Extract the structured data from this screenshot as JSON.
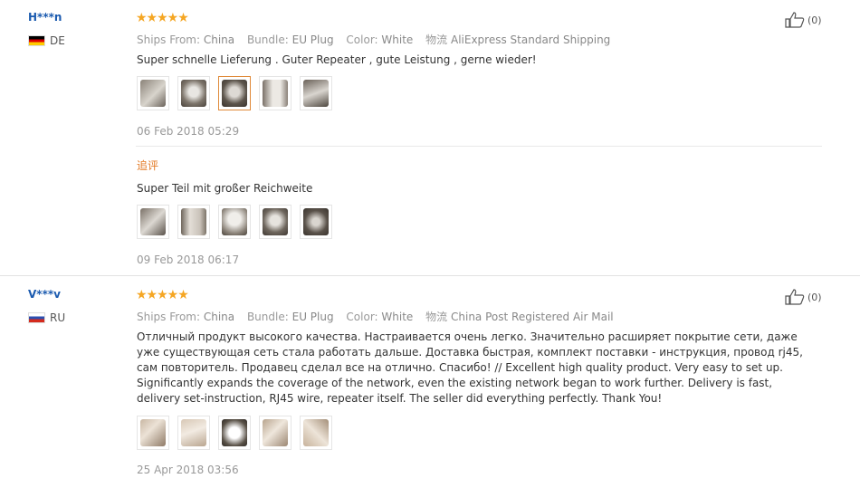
{
  "reviews": [
    {
      "user": "H***n",
      "country": "DE",
      "stars": "★★★★★",
      "likes": "(0)",
      "ships_from_label": "Ships From:",
      "ships_from": "China",
      "bundle_label": "Bundle:",
      "bundle": "EU Plug",
      "color_label": "Color:",
      "color": "White",
      "shipping_label": "物流",
      "shipping": "AliExpress Standard Shipping",
      "text": "Super schnelle Lieferung . Guter Repeater , gute Leistung , gerne wieder!",
      "date": "06 Feb 2018 05:29",
      "followup_label": "追评",
      "followup_text": "Super Teil mit großer Reichweite",
      "followup_date": "09 Feb 2018 06:17"
    },
    {
      "user": "V***v",
      "country": "RU",
      "stars": "★★★★★",
      "likes": "(0)",
      "ships_from_label": "Ships From:",
      "ships_from": "China",
      "bundle_label": "Bundle:",
      "bundle": "EU Plug",
      "color_label": "Color:",
      "color": "White",
      "shipping_label": "物流",
      "shipping": "China Post Registered Air Mail",
      "text": "Отличный продукт высокого качества. Настраивается очень легко. Значительно расширяет покрытие сети, даже уже существующая сеть стала работать дальше. Доставка быстрая, комплект поставки - инструкция, провод rj45, сам повторитель. Продавец сделал все на отлично. Спасибо! // Excellent high quality product. Very easy to set up. Significantly expands the coverage of the network, even the existing network began to work further. Delivery is fast, delivery set-instruction, RJ45 wire, repeater itself. The seller did everything perfectly. Thank You!",
      "date": "25 Apr 2018 03:56"
    }
  ],
  "colors": {
    "name": "#1a5aaf",
    "star": "#f5a623",
    "followup": "#e37a25",
    "active_thumb": "#e08a3a"
  },
  "icons": {
    "like": "thumbs-up-icon"
  }
}
